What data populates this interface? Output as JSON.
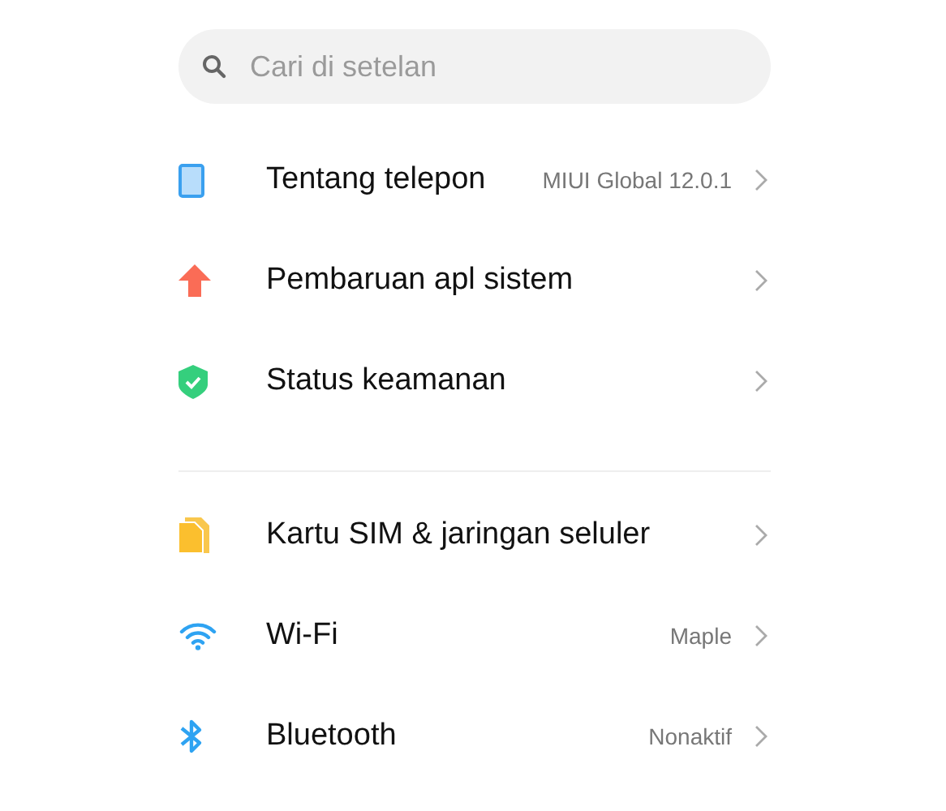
{
  "search": {
    "placeholder": "Cari di setelan"
  },
  "sections": [
    {
      "items": [
        {
          "kind": "phone",
          "label": "Tentang telepon",
          "value": "MIUI Global 12.0.1"
        },
        {
          "kind": "update",
          "label": "Pembaruan apl sistem"
        },
        {
          "kind": "security",
          "label": "Status keamanan"
        }
      ]
    },
    {
      "items": [
        {
          "kind": "sim",
          "label": "Kartu SIM & jaringan seluler"
        },
        {
          "kind": "wifi",
          "label": "Wi-Fi",
          "value": "Maple"
        },
        {
          "kind": "bluetooth",
          "label": "Bluetooth",
          "value": "Nonaktif"
        }
      ]
    }
  ]
}
